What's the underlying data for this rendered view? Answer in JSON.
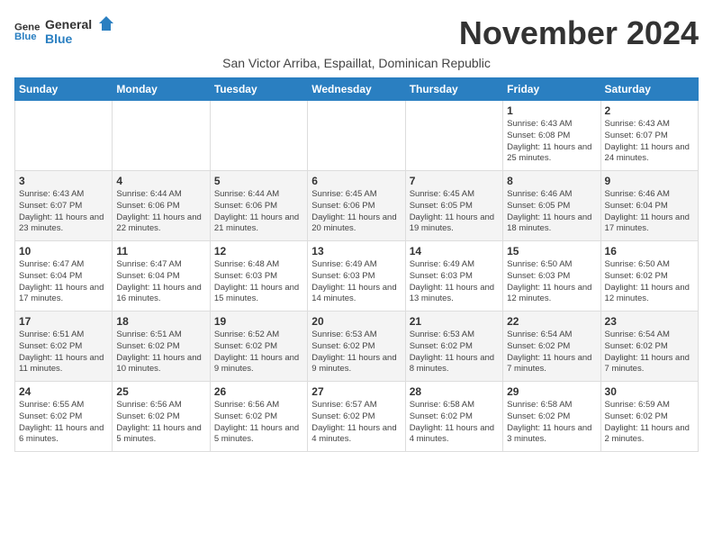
{
  "header": {
    "logo_line1": "General",
    "logo_line2": "Blue",
    "month_title": "November 2024",
    "subtitle": "San Victor Arriba, Espaillat, Dominican Republic"
  },
  "days_of_week": [
    "Sunday",
    "Monday",
    "Tuesday",
    "Wednesday",
    "Thursday",
    "Friday",
    "Saturday"
  ],
  "weeks": [
    [
      {
        "day": "",
        "info": ""
      },
      {
        "day": "",
        "info": ""
      },
      {
        "day": "",
        "info": ""
      },
      {
        "day": "",
        "info": ""
      },
      {
        "day": "",
        "info": ""
      },
      {
        "day": "1",
        "info": "Sunrise: 6:43 AM\nSunset: 6:08 PM\nDaylight: 11 hours and 25 minutes."
      },
      {
        "day": "2",
        "info": "Sunrise: 6:43 AM\nSunset: 6:07 PM\nDaylight: 11 hours and 24 minutes."
      }
    ],
    [
      {
        "day": "3",
        "info": "Sunrise: 6:43 AM\nSunset: 6:07 PM\nDaylight: 11 hours and 23 minutes."
      },
      {
        "day": "4",
        "info": "Sunrise: 6:44 AM\nSunset: 6:06 PM\nDaylight: 11 hours and 22 minutes."
      },
      {
        "day": "5",
        "info": "Sunrise: 6:44 AM\nSunset: 6:06 PM\nDaylight: 11 hours and 21 minutes."
      },
      {
        "day": "6",
        "info": "Sunrise: 6:45 AM\nSunset: 6:06 PM\nDaylight: 11 hours and 20 minutes."
      },
      {
        "day": "7",
        "info": "Sunrise: 6:45 AM\nSunset: 6:05 PM\nDaylight: 11 hours and 19 minutes."
      },
      {
        "day": "8",
        "info": "Sunrise: 6:46 AM\nSunset: 6:05 PM\nDaylight: 11 hours and 18 minutes."
      },
      {
        "day": "9",
        "info": "Sunrise: 6:46 AM\nSunset: 6:04 PM\nDaylight: 11 hours and 17 minutes."
      }
    ],
    [
      {
        "day": "10",
        "info": "Sunrise: 6:47 AM\nSunset: 6:04 PM\nDaylight: 11 hours and 17 minutes."
      },
      {
        "day": "11",
        "info": "Sunrise: 6:47 AM\nSunset: 6:04 PM\nDaylight: 11 hours and 16 minutes."
      },
      {
        "day": "12",
        "info": "Sunrise: 6:48 AM\nSunset: 6:03 PM\nDaylight: 11 hours and 15 minutes."
      },
      {
        "day": "13",
        "info": "Sunrise: 6:49 AM\nSunset: 6:03 PM\nDaylight: 11 hours and 14 minutes."
      },
      {
        "day": "14",
        "info": "Sunrise: 6:49 AM\nSunset: 6:03 PM\nDaylight: 11 hours and 13 minutes."
      },
      {
        "day": "15",
        "info": "Sunrise: 6:50 AM\nSunset: 6:03 PM\nDaylight: 11 hours and 12 minutes."
      },
      {
        "day": "16",
        "info": "Sunrise: 6:50 AM\nSunset: 6:02 PM\nDaylight: 11 hours and 12 minutes."
      }
    ],
    [
      {
        "day": "17",
        "info": "Sunrise: 6:51 AM\nSunset: 6:02 PM\nDaylight: 11 hours and 11 minutes."
      },
      {
        "day": "18",
        "info": "Sunrise: 6:51 AM\nSunset: 6:02 PM\nDaylight: 11 hours and 10 minutes."
      },
      {
        "day": "19",
        "info": "Sunrise: 6:52 AM\nSunset: 6:02 PM\nDaylight: 11 hours and 9 minutes."
      },
      {
        "day": "20",
        "info": "Sunrise: 6:53 AM\nSunset: 6:02 PM\nDaylight: 11 hours and 9 minutes."
      },
      {
        "day": "21",
        "info": "Sunrise: 6:53 AM\nSunset: 6:02 PM\nDaylight: 11 hours and 8 minutes."
      },
      {
        "day": "22",
        "info": "Sunrise: 6:54 AM\nSunset: 6:02 PM\nDaylight: 11 hours and 7 minutes."
      },
      {
        "day": "23",
        "info": "Sunrise: 6:54 AM\nSunset: 6:02 PM\nDaylight: 11 hours and 7 minutes."
      }
    ],
    [
      {
        "day": "24",
        "info": "Sunrise: 6:55 AM\nSunset: 6:02 PM\nDaylight: 11 hours and 6 minutes."
      },
      {
        "day": "25",
        "info": "Sunrise: 6:56 AM\nSunset: 6:02 PM\nDaylight: 11 hours and 5 minutes."
      },
      {
        "day": "26",
        "info": "Sunrise: 6:56 AM\nSunset: 6:02 PM\nDaylight: 11 hours and 5 minutes."
      },
      {
        "day": "27",
        "info": "Sunrise: 6:57 AM\nSunset: 6:02 PM\nDaylight: 11 hours and 4 minutes."
      },
      {
        "day": "28",
        "info": "Sunrise: 6:58 AM\nSunset: 6:02 PM\nDaylight: 11 hours and 4 minutes."
      },
      {
        "day": "29",
        "info": "Sunrise: 6:58 AM\nSunset: 6:02 PM\nDaylight: 11 hours and 3 minutes."
      },
      {
        "day": "30",
        "info": "Sunrise: 6:59 AM\nSunset: 6:02 PM\nDaylight: 11 hours and 2 minutes."
      }
    ]
  ]
}
